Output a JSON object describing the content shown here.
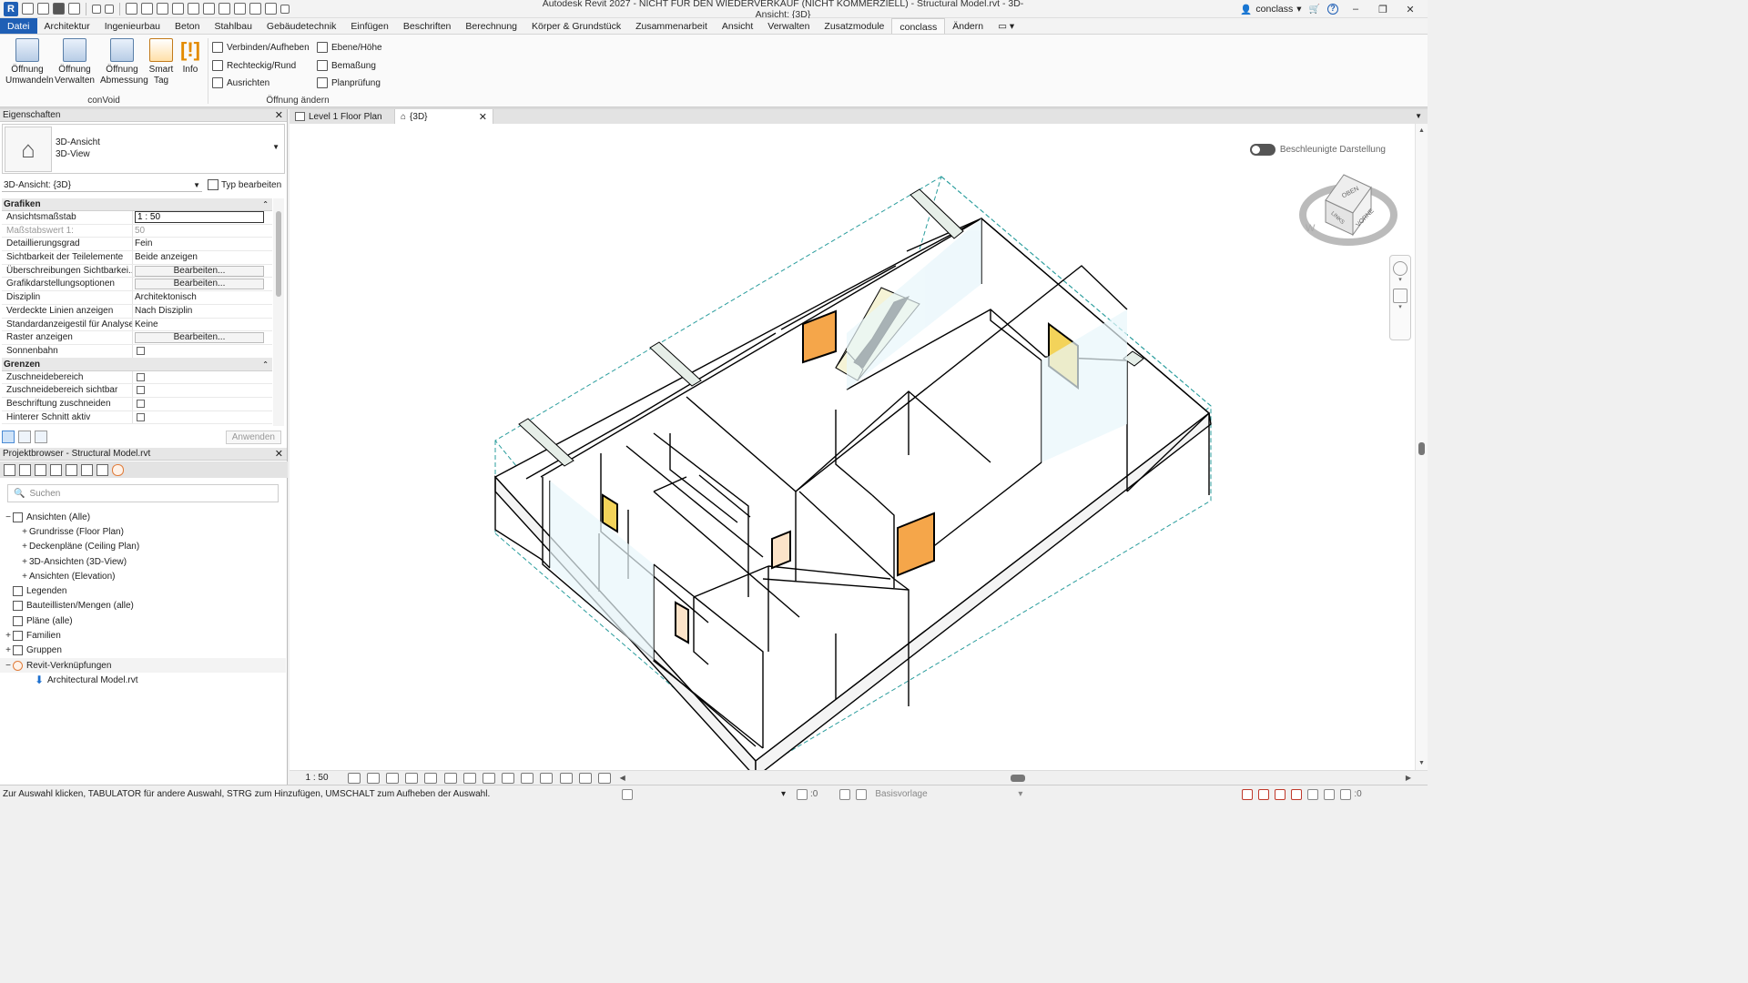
{
  "titlebar": {
    "logo": "R",
    "title": "Autodesk Revit 2027 - NICHT FÜR DEN WIEDERVERKAUF (NICHT KOMMERZIELL) - Structural Model.rvt - 3D-Ansicht: {3D}",
    "user": "conclass",
    "help": "?",
    "window_buttons": [
      "–",
      "❐",
      "✕"
    ]
  },
  "ribbon_tabs": [
    "Datei",
    "Architektur",
    "Ingenieurbau",
    "Beton",
    "Stahlbau",
    "Gebäudetechnik",
    "Einfügen",
    "Beschriften",
    "Berechnung",
    "Körper & Grundstück",
    "Zusammenarbeit",
    "Ansicht",
    "Verwalten",
    "Zusatzmodule",
    "conclass",
    "Ändern"
  ],
  "ribbon_tab_active_index": 14,
  "ribbon": {
    "panel_convoid": {
      "label": "conVoid",
      "buttons": [
        {
          "label": "Öffnung Umwandeln",
          "icon": "opening-convert-icon"
        },
        {
          "label": "Öffnung Verwalten",
          "icon": "opening-manage-icon"
        },
        {
          "label": "Öffnung Abmessung",
          "icon": "opening-dimension-icon"
        },
        {
          "label": "Smart Tag",
          "icon": "smart-tag-icon"
        },
        {
          "label": "Info",
          "icon": "info-icon"
        }
      ]
    },
    "panel_oeffnung": {
      "label": "Öffnung ändern",
      "buttons": [
        {
          "label": "Verbinden/Aufheben",
          "icon": "join-icon"
        },
        {
          "label": "Rechteckig/Rund",
          "icon": "rect-round-icon"
        },
        {
          "label": "Ausrichten",
          "icon": "align-icon"
        },
        {
          "label": "Ebene/Höhe",
          "icon": "level-height-icon"
        },
        {
          "label": "Bemaßung",
          "icon": "dimension-icon"
        },
        {
          "label": "Planprüfung",
          "icon": "plan-check-icon"
        }
      ]
    }
  },
  "properties": {
    "title": "Eigenschaften",
    "type_line1": "3D-Ansicht",
    "type_line2": "3D-View",
    "instance": "3D-Ansicht: {3D}",
    "edit_type": "Typ bearbeiten",
    "groups": [
      {
        "name": "Grafiken",
        "rows": [
          {
            "key": "Ansichtsmaßstab",
            "value": "1 : 50",
            "kind": "input"
          },
          {
            "key": "Maßstabswert 1:",
            "value": "50",
            "kind": "grey"
          },
          {
            "key": "Detaillierungsgrad",
            "value": "Fein",
            "kind": "text"
          },
          {
            "key": "Sichtbarkeit der Teilelemente",
            "value": "Beide anzeigen",
            "kind": "text"
          },
          {
            "key": "Überschreibungen Sichtbarkei...",
            "value": "Bearbeiten...",
            "kind": "button"
          },
          {
            "key": "Grafikdarstellungsoptionen",
            "value": "Bearbeiten...",
            "kind": "button"
          },
          {
            "key": "Disziplin",
            "value": "Architektonisch",
            "kind": "text"
          },
          {
            "key": "Verdeckte Linien anzeigen",
            "value": "Nach Disziplin",
            "kind": "text"
          },
          {
            "key": "Standardanzeigestil für Analyse",
            "value": "Keine",
            "kind": "text"
          },
          {
            "key": "Raster anzeigen",
            "value": "Bearbeiten...",
            "kind": "button"
          },
          {
            "key": "Sonnenbahn",
            "value": "",
            "kind": "checkbox"
          }
        ]
      },
      {
        "name": "Grenzen",
        "rows": [
          {
            "key": "Zuschneidebereich",
            "value": "",
            "kind": "checkbox"
          },
          {
            "key": "Zuschneidebereich sichtbar",
            "value": "",
            "kind": "checkbox"
          },
          {
            "key": "Beschriftung zuschneiden",
            "value": "",
            "kind": "checkbox"
          },
          {
            "key": "Hinterer Schnitt aktiv",
            "value": "",
            "kind": "checkbox"
          }
        ]
      }
    ],
    "apply": "Anwenden"
  },
  "browser": {
    "title": "Projektbrowser - Structural Model.rvt",
    "search_placeholder": "Suchen",
    "tree": [
      {
        "label": "Ansichten (Alle)",
        "level": 0,
        "exp": "−",
        "icon": "views-icon"
      },
      {
        "label": "Grundrisse (Floor Plan)",
        "level": 1,
        "exp": "+",
        "icon": ""
      },
      {
        "label": "Deckenpläne (Ceiling Plan)",
        "level": 1,
        "exp": "+",
        "icon": ""
      },
      {
        "label": "3D-Ansichten (3D-View)",
        "level": 1,
        "exp": "+",
        "icon": ""
      },
      {
        "label": "Ansichten (Elevation)",
        "level": 1,
        "exp": "+",
        "icon": ""
      },
      {
        "label": "Legenden",
        "level": 0,
        "exp": "",
        "icon": "legend-icon"
      },
      {
        "label": "Bauteillisten/Mengen (alle)",
        "level": 0,
        "exp": "",
        "icon": "schedule-icon"
      },
      {
        "label": "Pläne (alle)",
        "level": 0,
        "exp": "",
        "icon": "sheets-icon"
      },
      {
        "label": "Familien",
        "level": 0,
        "exp": "+",
        "icon": "families-icon"
      },
      {
        "label": "Gruppen",
        "level": 0,
        "exp": "+",
        "icon": "groups-icon"
      },
      {
        "label": "Revit-Verknüpfungen",
        "level": 0,
        "exp": "−",
        "icon": "link-icon"
      },
      {
        "label": "Architectural Model.rvt",
        "level": 2,
        "exp": "",
        "icon": "arrow-down-icon"
      }
    ]
  },
  "view": {
    "tabs": [
      {
        "label": "Level 1 Floor Plan",
        "icon": "floor-plan-icon"
      },
      {
        "label": "{3D}",
        "icon": "house-icon"
      }
    ],
    "accelerated": "Beschleunigte Darstellung",
    "viewcube": {
      "top": "OBEN",
      "left": "LINKS",
      "front": "VORNE",
      "compass": "W"
    },
    "scale": "1 : 50"
  },
  "status": {
    "hint": "Zur Auswahl klicken, TABULATOR für andere Auswahl, STRG zum Hinzufügen, UMSCHALT zum Aufheben der Auswahl.",
    "worksets_count": ":0",
    "base_template": "Basisvorlage",
    "filter_count": ":0"
  },
  "colors": {
    "accent": "#1f5fb5",
    "crop_dash": "#2a9d9d",
    "door_fill": "#f3d35a"
  }
}
